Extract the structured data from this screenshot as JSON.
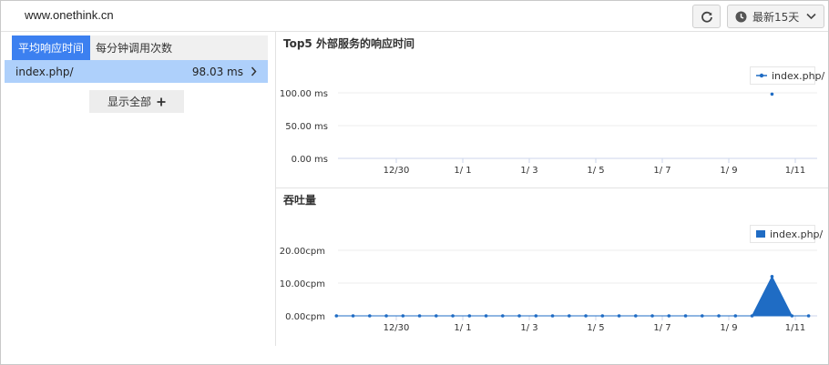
{
  "header": {
    "site_title": "www.onethink.cn",
    "range_label": "最新15天"
  },
  "icons": {
    "refresh": "refresh-icon",
    "clock": "clock-icon",
    "chevron": "chevron-down-icon",
    "plus": "plus-icon",
    "arrow": "chevron-right-icon"
  },
  "left": {
    "tabs": [
      {
        "label": "平均响应时间"
      },
      {
        "label": "每分钟调用次数"
      }
    ],
    "rows": [
      {
        "name": "index.php/",
        "value": "98.03 ms"
      }
    ],
    "show_all": "显示全部"
  },
  "colors": {
    "accent": "#3c80f0",
    "series": "#1f6cc4",
    "row": "#aed0fb"
  },
  "chart_data": [
    {
      "type": "line",
      "title": "Top5 外部服务的响应时间",
      "x_ticks": [
        "12/30",
        "1/ 1",
        "1/ 3",
        "1/ 5",
        "1/ 7",
        "1/ 9",
        "1/11"
      ],
      "y_ticks": [
        "0.00 ms",
        "50.00 ms",
        "100.00 ms"
      ],
      "ylim": [
        0,
        100
      ],
      "series": [
        {
          "name": "index.php/",
          "points": [
            {
              "x": 11.3,
              "y": 98.03
            }
          ]
        }
      ],
      "legend": "top-right",
      "grid": true
    },
    {
      "type": "area",
      "title": "吞吐量",
      "x_ticks": [
        "12/30",
        "1/ 1",
        "1/ 3",
        "1/ 5",
        "1/ 7",
        "1/ 9",
        "1/11"
      ],
      "y_ticks": [
        "0.00cpm",
        "10.00cpm",
        "20.00cpm"
      ],
      "ylim": [
        0,
        20
      ],
      "series": [
        {
          "name": "index.php/",
          "points": [
            {
              "x": -1.8,
              "y": 0
            },
            {
              "x": -1.3,
              "y": 0
            },
            {
              "x": -0.8,
              "y": 0
            },
            {
              "x": -0.3,
              "y": 0
            },
            {
              "x": 0.2,
              "y": 0
            },
            {
              "x": 0.7,
              "y": 0
            },
            {
              "x": 1.2,
              "y": 0
            },
            {
              "x": 1.7,
              "y": 0
            },
            {
              "x": 2.2,
              "y": 0
            },
            {
              "x": 2.7,
              "y": 0
            },
            {
              "x": 3.2,
              "y": 0
            },
            {
              "x": 3.7,
              "y": 0
            },
            {
              "x": 4.2,
              "y": 0
            },
            {
              "x": 4.7,
              "y": 0
            },
            {
              "x": 5.2,
              "y": 0
            },
            {
              "x": 5.7,
              "y": 0
            },
            {
              "x": 6.2,
              "y": 0
            },
            {
              "x": 6.7,
              "y": 0
            },
            {
              "x": 7.2,
              "y": 0
            },
            {
              "x": 7.7,
              "y": 0
            },
            {
              "x": 8.2,
              "y": 0
            },
            {
              "x": 8.7,
              "y": 0
            },
            {
              "x": 9.2,
              "y": 0
            },
            {
              "x": 9.7,
              "y": 0
            },
            {
              "x": 10.2,
              "y": 0
            },
            {
              "x": 10.7,
              "y": 0
            },
            {
              "x": 11.3,
              "y": 12
            },
            {
              "x": 11.9,
              "y": 0
            },
            {
              "x": 12.4,
              "y": 0
            }
          ]
        }
      ],
      "legend": "top-right",
      "grid": true
    }
  ]
}
